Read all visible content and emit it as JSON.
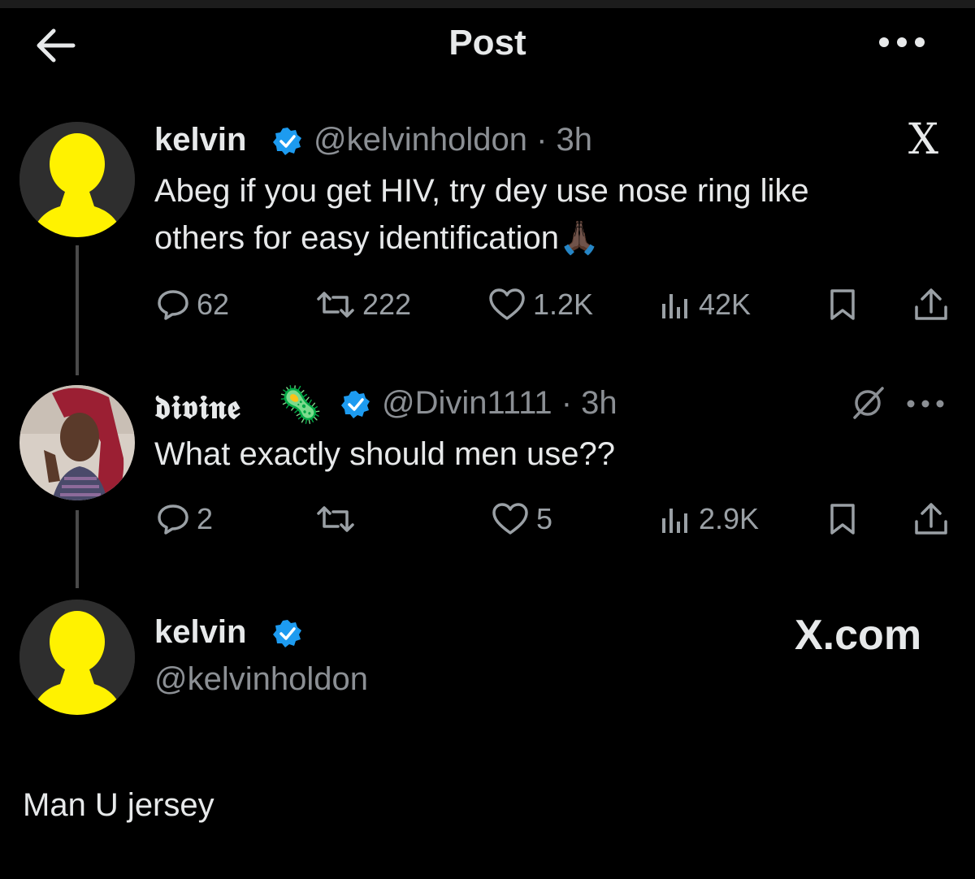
{
  "header": {
    "title": "Post"
  },
  "tweet1": {
    "name": "kelvin",
    "handle": "@kelvinholdon",
    "time": "· 3h",
    "text_line1": "Abeg if you get HIV, try dey use nose ring like",
    "text_line2": "others for easy identification",
    "emoji": "🙏🏿",
    "replies": "62",
    "reposts": "222",
    "likes": "1.2K",
    "views": "42K",
    "x_logo": "X"
  },
  "tweet2": {
    "name": "𝖉𝖎𝖛𝖎𝖓𝖊",
    "name_emoji": "🦠",
    "handle": "@Divin1111",
    "time": "· 3h",
    "text": "What exactly should men use??",
    "replies": "2",
    "likes": "5",
    "views": "2.9K"
  },
  "tweet3": {
    "name": "kelvin",
    "handle": "@kelvinholdon",
    "brand": "X.com",
    "text": "Man U jersey"
  },
  "colors": {
    "background": "#000000",
    "text": "#e7e9ea",
    "muted": "#8b8f94",
    "verified": "#1d9bf0",
    "avatar_yellow": "#fff200"
  },
  "icons": [
    "back-arrow-icon",
    "more-icon",
    "verified-icon",
    "reply-icon",
    "repost-icon",
    "like-icon",
    "views-icon",
    "bookmark-icon",
    "share-icon",
    "grok-icon",
    "virus-emoji"
  ]
}
